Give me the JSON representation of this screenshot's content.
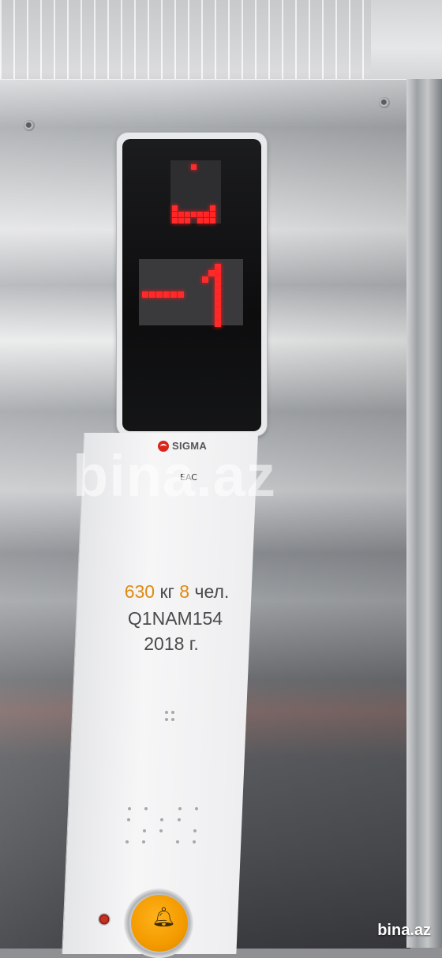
{
  "display": {
    "direction": "down",
    "floor": "-1",
    "led_color": "#ff2a2a"
  },
  "faceplate": {
    "brand": "SIGMA",
    "certification": "EAC",
    "capacity_kg": "630",
    "capacity_kg_unit": "кг",
    "capacity_persons": "8",
    "capacity_persons_unit": "чел.",
    "model": "Q1NAM154",
    "year": "2018 г.",
    "alarm_icon": "bell-icon"
  },
  "watermark": {
    "large": "bina.az",
    "corner": "bina.az"
  }
}
